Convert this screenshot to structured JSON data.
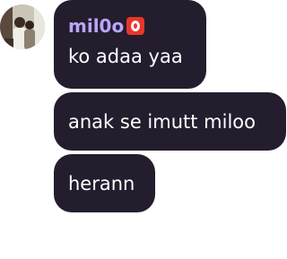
{
  "sender": {
    "username": "mil0o",
    "badge_icon": "red-o-button-emoji",
    "avatar": "profile-photo"
  },
  "messages": [
    {
      "text": "ko adaa yaa"
    },
    {
      "text": "anak se imutt miloo"
    },
    {
      "text": "herann"
    }
  ],
  "colors": {
    "bubble": "#241d2e",
    "username": "#b9a6ff",
    "message_text": "#ffffff",
    "badge": "#e8362b",
    "background": "#ffffff"
  }
}
